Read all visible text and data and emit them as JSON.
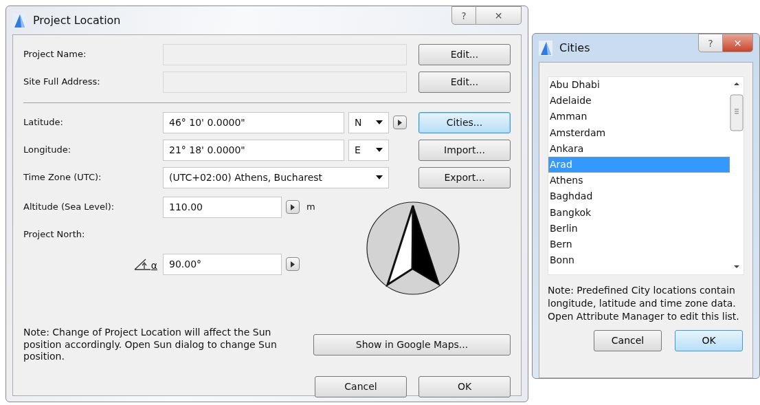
{
  "project_location_dialog": {
    "title": "Project Location",
    "title_buttons": [
      "?",
      "✕"
    ],
    "identity_rows": [
      {
        "label": "Project Name:",
        "disabled": true,
        "button": "Edit..."
      },
      {
        "label": "Site Full Address:",
        "disabled": true,
        "button": "Edit..."
      }
    ],
    "location_rows": [
      {
        "kind": "coordinate",
        "label": "Latitude:",
        "value": "46° 10' 0.0000\"",
        "hemisphere": "N",
        "button": "Cities...",
        "focused": true
      },
      {
        "kind": "coordinate",
        "label": "Longitude:",
        "value": "21° 18' 0.0000\"",
        "hemisphere": "E",
        "button": "Import...",
        "focused": false
      },
      {
        "kind": "dropdown",
        "label": "Time Zone (UTC):",
        "value": "(UTC+02:00) Athens, Bucharest",
        "button": "Export...",
        "focused": false
      }
    ],
    "altitude": {
      "label": "Altitude (Sea Level):",
      "value": "110.00",
      "unit": "m"
    },
    "project_north": {
      "label": "Project North:",
      "angle_symbol": "α",
      "value": "90.00°"
    },
    "note": "Note: Change of Project Location will affect the Sun position accordingly. Open Sun dialog to change Sun position.",
    "maps_button": "Show in Google Maps...",
    "buttons": [
      {
        "label": "Cancel",
        "focused": false
      },
      {
        "label": "OK",
        "focused": false
      }
    ]
  },
  "cities_dialog": {
    "title": "Cities",
    "title_buttons": [
      "?",
      "✕"
    ],
    "cities": [
      {
        "name": "Abu Dhabi",
        "selected": false
      },
      {
        "name": "Adelaide",
        "selected": false
      },
      {
        "name": "Amman",
        "selected": false
      },
      {
        "name": "Amsterdam",
        "selected": false
      },
      {
        "name": "Ankara",
        "selected": false
      },
      {
        "name": "Arad",
        "selected": true
      },
      {
        "name": "Athens",
        "selected": false
      },
      {
        "name": "Baghdad",
        "selected": false
      },
      {
        "name": "Bangkok",
        "selected": false
      },
      {
        "name": "Berlin",
        "selected": false
      },
      {
        "name": "Bern",
        "selected": false
      },
      {
        "name": "Bonn",
        "selected": false
      }
    ],
    "note": "Note: Predefined City locations contain longitude, latitude and time zone data. Open Attribute Manager to edit this list.",
    "buttons": [
      {
        "label": "Cancel",
        "focused": false
      },
      {
        "label": "OK",
        "focused": true
      }
    ]
  }
}
